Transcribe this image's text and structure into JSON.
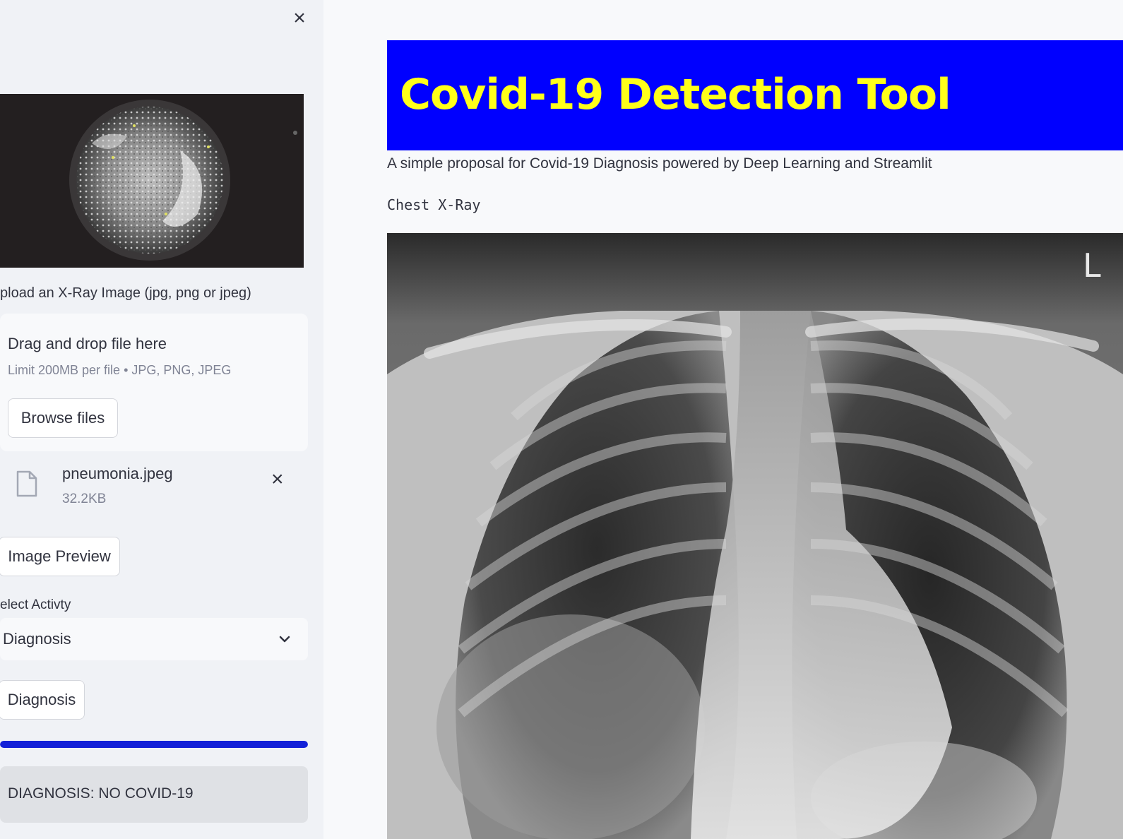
{
  "sidebar": {
    "close_icon": "close-icon",
    "banner_image": "coronavirus-illustration",
    "upload_label": "pload an X-Ray Image (jpg, png or jpeg)",
    "dropzone": {
      "title": "Drag and drop file here",
      "limit": "Limit 200MB per file • JPG, PNG, JPEG",
      "browse_label": "Browse files"
    },
    "file": {
      "name": "pneumonia.jpeg",
      "size": "32.2KB",
      "icon": "file-icon",
      "remove_icon": "close-icon"
    },
    "image_preview_label": "Image Preview",
    "select_label": "elect Activty",
    "select_value": "Diagnosis",
    "diagnosis_button_label": "Diagnosis",
    "progress": 1.0,
    "result_text": "DIAGNOSIS: NO COVID-19"
  },
  "main": {
    "title": "Covid-19 Detection Tool",
    "subtitle": "A simple proposal for Covid-19 Diagnosis powered by Deep Learning and Streamlit",
    "image_caption": "Chest X-Ray",
    "xray_marker": "L"
  },
  "colors": {
    "title_bg": "#0000ff",
    "title_text": "#ffff1a",
    "progress": "#1321d8",
    "sidebar_bg": "#f0f2f6",
    "result_bg": "#dfe1e5"
  }
}
